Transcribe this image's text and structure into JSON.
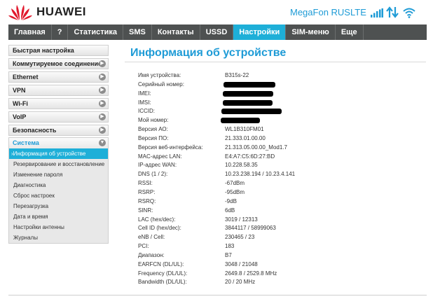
{
  "header": {
    "brand": "HUAWEI",
    "operator": "MegaFon RUS",
    "network_type": "LTE",
    "accent_color": "#1e9bd6",
    "logo_color": "#e1192d"
  },
  "topnav": [
    {
      "label": "Главная",
      "active": false
    },
    {
      "label": "?",
      "active": false
    },
    {
      "label": "Статистика",
      "active": false
    },
    {
      "label": "SMS",
      "active": false
    },
    {
      "label": "Контакты",
      "active": false
    },
    {
      "label": "USSD",
      "active": false
    },
    {
      "label": "Настройки",
      "active": true
    },
    {
      "label": "SIM-меню",
      "active": false
    },
    {
      "label": "Еще",
      "active": false
    }
  ],
  "sidebar": {
    "items": [
      {
        "label": "Быстрая настройка",
        "arrow": false
      },
      {
        "label": "Коммутируемое соединение",
        "arrow": true
      },
      {
        "label": "Ethernet",
        "arrow": true
      },
      {
        "label": "VPN",
        "arrow": true
      },
      {
        "label": "Wi-Fi",
        "arrow": true
      },
      {
        "label": "VoIP",
        "arrow": true
      },
      {
        "label": "Безопасность",
        "arrow": true
      }
    ],
    "group": {
      "label": "Система",
      "subitems": [
        {
          "label": "›Информация об устройстве",
          "active": true
        },
        {
          "label": "Резервирование и восстановление",
          "active": false
        },
        {
          "label": "Изменение пароля",
          "active": false
        },
        {
          "label": "Диагностика",
          "active": false
        },
        {
          "label": "Сброс настроек",
          "active": false
        },
        {
          "label": "Перезагрузка",
          "active": false
        },
        {
          "label": "Дата и время",
          "active": false
        },
        {
          "label": "Настройки антенны",
          "active": false
        },
        {
          "label": "Журналы",
          "active": false
        }
      ]
    }
  },
  "main": {
    "title": "Информация об устройстве",
    "rows": [
      {
        "label": "Имя устройства:",
        "value": "B315s-22",
        "redacted": false
      },
      {
        "label": "Серийный номер:",
        "value": "",
        "redacted": true
      },
      {
        "label": "IMEI:",
        "value": "",
        "redacted": true
      },
      {
        "label": "IMSI:",
        "value": "",
        "redacted": true
      },
      {
        "label": "ICCID:",
        "value": "",
        "redacted": true
      },
      {
        "label": "Мой номер:",
        "value": "",
        "redacted": true
      },
      {
        "label": "Версия АО:",
        "value": "WL1B310FM01",
        "redacted": false
      },
      {
        "label": "Версия ПО:",
        "value": "21.333.01.00.00",
        "redacted": false
      },
      {
        "label": "Версия веб-интерфейса:",
        "value": "21.313.05.00.00_Mod1.7",
        "redacted": false
      },
      {
        "label": "MAC-адрес LAN:",
        "value": "E4:A7:C5:6D:27:BD",
        "redacted": false
      },
      {
        "label": "IP-адрес WAN:",
        "value": "10.228.58.35",
        "redacted": false
      },
      {
        "label": "DNS (1 / 2):",
        "value": "10.23.238.194 / 10.23.4.141",
        "redacted": false
      },
      {
        "label": "RSSI:",
        "value": "-67dBm",
        "redacted": false
      },
      {
        "label": "RSRP:",
        "value": "-95dBm",
        "redacted": false
      },
      {
        "label": "RSRQ:",
        "value": "-9dB",
        "redacted": false
      },
      {
        "label": "SINR:",
        "value": "6dB",
        "redacted": false
      },
      {
        "label": "LAC (hex/dec):",
        "value": "3019 / 12313",
        "redacted": false
      },
      {
        "label": "Cell ID (hex/dec):",
        "value": "3844117 / 58999063",
        "redacted": false
      },
      {
        "label": "eNB / Cell:",
        "value": "230465 / 23",
        "redacted": false
      },
      {
        "label": "PCI:",
        "value": "183",
        "redacted": false
      },
      {
        "label": "Диапазон:",
        "value": "B7",
        "redacted": false
      },
      {
        "label": "EARFCN (DL/UL):",
        "value": "3048 / 21048",
        "redacted": false
      },
      {
        "label": "Frequency (DL/UL):",
        "value": "2649.8 / 2529.8 MHz",
        "redacted": false
      },
      {
        "label": "Bandwidth (DL/UL):",
        "value": "20 / 20 MHz",
        "redacted": false
      }
    ]
  }
}
